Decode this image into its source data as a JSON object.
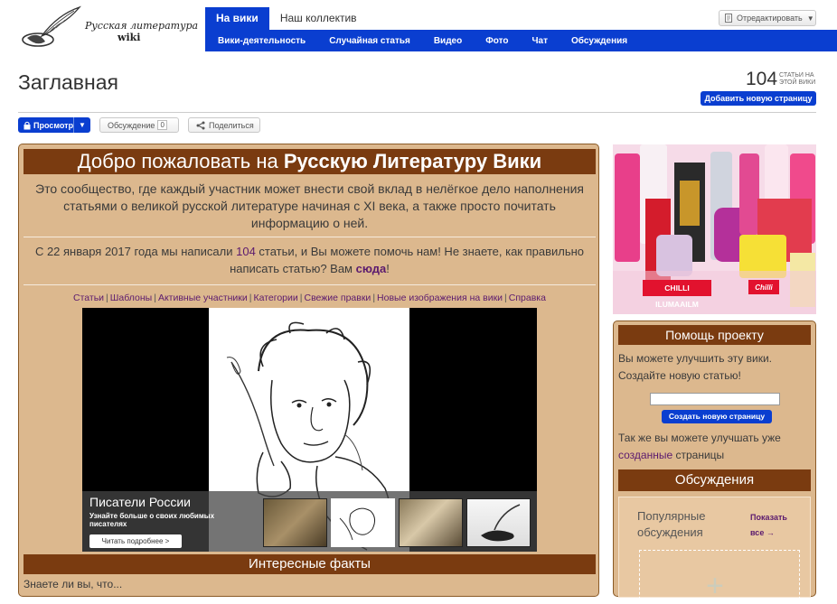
{
  "header": {
    "logo_line1": "Русская литература",
    "logo_line2": "wiki",
    "tabs": [
      {
        "label": "На вики",
        "active": true
      },
      {
        "label": "Наш коллектив",
        "active": false
      }
    ],
    "subnav": [
      "Вики-деятельность",
      "Случайная статья",
      "Видео",
      "Фото",
      "Чат",
      "Обсуждения"
    ],
    "edit_label": "Отредактировать"
  },
  "page": {
    "title": "Заглавная",
    "article_count": "104",
    "article_count_label": "СТАТЬИ НА ЭТОЙ ВИКИ",
    "add_page_label": "Добавить новую страницу",
    "view_label": "Просмотр",
    "discussion_label": "Обсуждение",
    "discussion_count": "0",
    "share_label": "Поделиться"
  },
  "main": {
    "welcome_prefix": "Добро пожаловать на ",
    "welcome_bold": "Русскую Литературу Вики",
    "intro": "Это сообщество, где каждый участник может внести свой вклад в нелёгкое дело наполнения статьями о великой русской литературе начиная с XI века, а также просто почитать информацию о ней.",
    "since_part1": "С 22 января 2017 года мы написали ",
    "since_count": "104",
    "since_part2": " статьи, и Вы можете помочь нам! Не знаете, как правильно написать статью? Вам ",
    "since_link": "сюда",
    "since_end": "!",
    "links": [
      "Статьи",
      "Шаблоны",
      "Активные участники",
      "Категории",
      "Свежие правки",
      "Новые изображения на вики",
      "Справка"
    ],
    "slide_title": "Писатели России",
    "slide_desc": "Узнайте больше о своих любимых писателях",
    "slide_button": "Читать подробнее >",
    "facts_title": "Интересные факты",
    "facts_sub": "Знаете ли вы, что..."
  },
  "ad": {
    "brand": "CHILLI ILUMAAILM"
  },
  "help": {
    "title": "Помощь проекту",
    "text": "Вы можете улучшить эту вики. Создайте новую статью!",
    "input_placeholder": "",
    "create_label": "Создать новую страницу",
    "also_part1": "Так же вы можете улучшать уже ",
    "also_link": "созданные",
    "also_part2": " страницы",
    "discussions_title": "Обсуждения",
    "popular_label": "Популярные обсуждения",
    "show_all_label": "Показать все →"
  }
}
